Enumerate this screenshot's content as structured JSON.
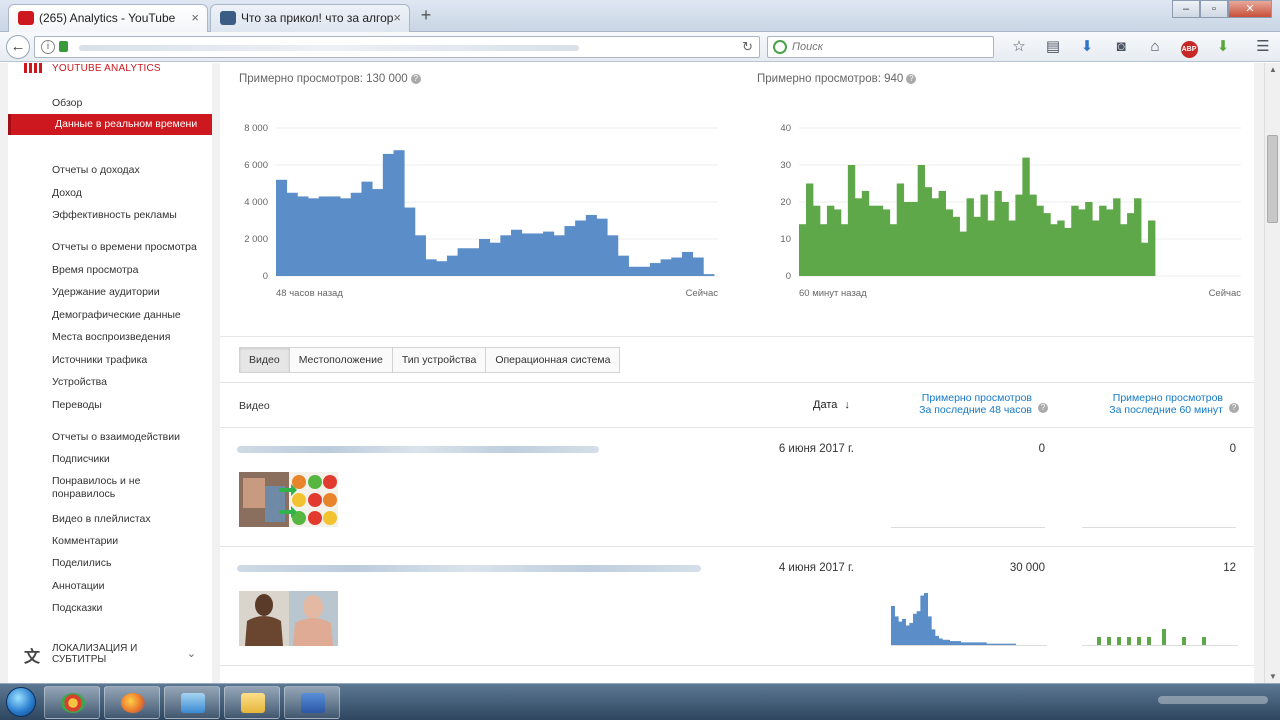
{
  "browser": {
    "tabs": [
      {
        "title": "(265) Analytics - YouTube",
        "close": "×"
      },
      {
        "title": "Что за прикол! что за алгор",
        "close": "×"
      }
    ],
    "new_tab": "+",
    "window_buttons": {
      "minimize": "‒",
      "maximize": "▫",
      "close": "✕"
    },
    "search_placeholder": "Поиск",
    "colors": {
      "youtube_red": "#cc181e",
      "abp_red": "#c62828"
    }
  },
  "sidebar": {
    "title": "YOUTUBE ANALYTICS",
    "items": [
      {
        "label": "Обзор"
      },
      {
        "label": "Данные в реальном времени",
        "active": true
      },
      {
        "label": "Отчеты о доходах"
      },
      {
        "label": "Доход"
      },
      {
        "label": "Эффективность рекламы"
      },
      {
        "label": "Отчеты о времени просмотра"
      },
      {
        "label": "Время просмотра"
      },
      {
        "label": "Удержание аудитории"
      },
      {
        "label": "Демографические данные"
      },
      {
        "label": "Места воспроизведения"
      },
      {
        "label": "Источники трафика"
      },
      {
        "label": "Устройства"
      },
      {
        "label": "Переводы"
      },
      {
        "label": "Отчеты о взаимодействии"
      },
      {
        "label": "Подписчики"
      },
      {
        "label": "Понравилось и не понравилось"
      },
      {
        "label": "Видео в плейлистах"
      },
      {
        "label": "Комментарии"
      },
      {
        "label": "Поделились"
      },
      {
        "label": "Аннотации"
      },
      {
        "label": "Подсказки"
      }
    ],
    "localization": "ЛОКАЛИЗАЦИЯ И СУБТИТРЫ"
  },
  "charts": {
    "left_title": "Примерно просмотров: 130 000",
    "right_title": "Примерно просмотров: 940",
    "help": "?"
  },
  "chart_data": [
    {
      "type": "bar",
      "color": "#5b8ec9",
      "x_start_label": "48 часов назад",
      "x_end_label": "Сейчас",
      "ylim": [
        0,
        8000
      ],
      "yticks": [
        "8 000",
        "6 000",
        "4 000",
        "2 000",
        "0"
      ],
      "values": [
        5200,
        4500,
        4300,
        4200,
        4300,
        4300,
        4200,
        4500,
        5100,
        4700,
        6600,
        6800,
        3700,
        2200,
        900,
        800,
        1100,
        1500,
        1500,
        2000,
        1800,
        2200,
        2500,
        2300,
        2300,
        2400,
        2200,
        2700,
        3000,
        3300,
        3100,
        2200,
        1100,
        500,
        500,
        700,
        900,
        1000,
        1300,
        1000,
        100
      ]
    },
    {
      "type": "bar",
      "color": "#5ea84a",
      "x_start_label": "60 минут назад",
      "x_end_label": "Сейчас",
      "ylim": [
        0,
        40
      ],
      "yticks": [
        "40",
        "30",
        "20",
        "10",
        "0"
      ],
      "values": [
        14,
        25,
        19,
        14,
        19,
        18,
        14,
        30,
        21,
        23,
        19,
        19,
        18,
        14,
        25,
        20,
        20,
        30,
        24,
        21,
        23,
        18,
        16,
        12,
        21,
        16,
        22,
        15,
        23,
        20,
        15,
        22,
        32,
        22,
        19,
        17,
        14,
        15,
        13,
        19,
        18,
        20,
        15,
        19,
        18,
        21,
        14,
        17,
        21,
        9,
        15
      ]
    }
  ],
  "tabs": [
    {
      "label": "Видео",
      "selected": true
    },
    {
      "label": "Местоположение"
    },
    {
      "label": "Тип устройства"
    },
    {
      "label": "Операционная система"
    }
  ],
  "table": {
    "headers": {
      "video": "Видео",
      "date": "Дата",
      "sort_arrow": "↓",
      "views48_line1": "Примерно просмотров",
      "views48_line2": "За последние 48 часов",
      "views60_line1": "Примерно просмотров",
      "views60_line2": "За последние 60 минут"
    },
    "rows": [
      {
        "date": "6 июня 2017 г.",
        "views48": "0",
        "views60": "0",
        "spark48": [],
        "spark60": []
      },
      {
        "date": "4 июня 2017 г.",
        "views48": "30 000",
        "views60": "12",
        "spark48": [
          30,
          22,
          18,
          20,
          15,
          17,
          24,
          26,
          38,
          40,
          22,
          12,
          7,
          5,
          4,
          4,
          3,
          3,
          3,
          2,
          2,
          2,
          2,
          2,
          2,
          2,
          1,
          1,
          1,
          1,
          1,
          1,
          1,
          1
        ],
        "spark60": [
          0,
          1,
          0,
          1,
          0,
          1,
          0,
          1,
          0,
          1,
          0,
          1,
          0,
          0,
          2,
          0,
          0,
          0,
          1,
          0,
          0,
          0,
          1,
          0
        ]
      }
    ]
  }
}
